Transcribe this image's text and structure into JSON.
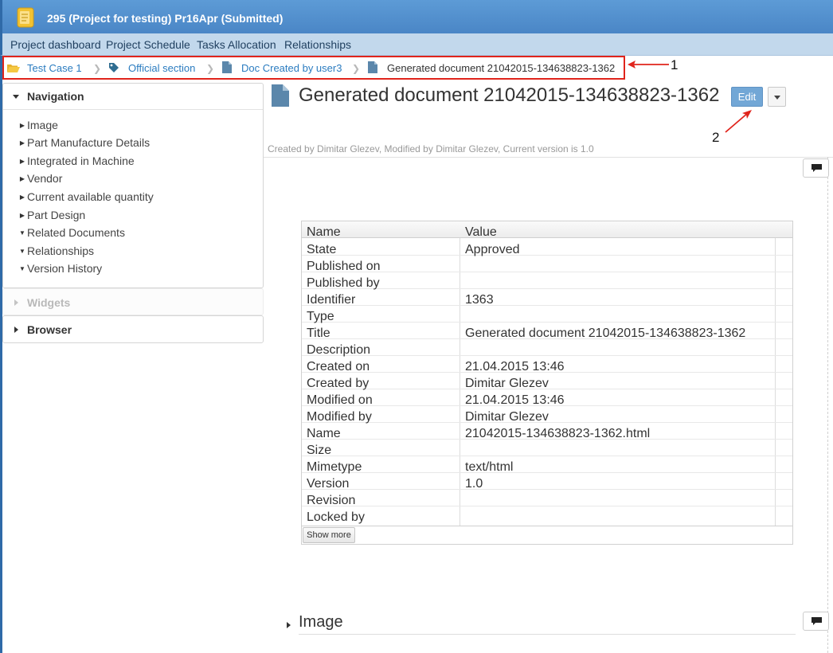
{
  "window": {
    "title": "295 (Project for testing) Pr16Apr (Submitted)"
  },
  "menu": {
    "items": [
      "Project dashboard",
      "Project Schedule",
      "Tasks Allocation",
      "Relationships"
    ]
  },
  "breadcrumb": {
    "items": [
      "Test Case 1",
      "Official section",
      "Doc Created by user3",
      "Generated document 21042015-134638823-1362"
    ]
  },
  "annotations": {
    "callout_1": "1",
    "callout_2": "2",
    "color": "#e0241c"
  },
  "navigation_panel": {
    "title": "Navigation",
    "items": [
      {
        "label": "Image",
        "expanded": false
      },
      {
        "label": "Part Manufacture Details",
        "expanded": false
      },
      {
        "label": "Integrated in Machine",
        "expanded": false
      },
      {
        "label": "Vendor",
        "expanded": false
      },
      {
        "label": "Current available quantity",
        "expanded": false
      },
      {
        "label": "Part Design",
        "expanded": false
      },
      {
        "label": "Related Documents",
        "expanded": true
      },
      {
        "label": "Relationships",
        "expanded": true
      },
      {
        "label": "Version History",
        "expanded": true
      }
    ]
  },
  "widgets_panel": {
    "title": "Widgets"
  },
  "browser_panel": {
    "title": "Browser"
  },
  "document": {
    "title": "Generated document 21042015-134638823-1362",
    "edit_label": "Edit",
    "meta": "Created by Dimitar Glezev, Modified by Dimitar Glezev, Current version is 1.0"
  },
  "properties": {
    "headers": [
      "Name",
      "Value"
    ],
    "rows": [
      [
        "State",
        "Approved"
      ],
      [
        "Published on",
        ""
      ],
      [
        "Published by",
        ""
      ],
      [
        "Identifier",
        "1363"
      ],
      [
        "Type",
        ""
      ],
      [
        "Title",
        "Generated document 21042015-134638823-1362"
      ],
      [
        "Description",
        ""
      ],
      [
        "Created on",
        "21.04.2015 13:46"
      ],
      [
        "Created by",
        "Dimitar Glezev"
      ],
      [
        "Modified on",
        "21.04.2015 13:46"
      ],
      [
        "Modified by",
        "Dimitar Glezev"
      ],
      [
        "Name",
        "21042015-134638823-1362.html"
      ],
      [
        "Size",
        ""
      ],
      [
        "Mimetype",
        "text/html"
      ],
      [
        "Version",
        "1.0"
      ],
      [
        "Revision",
        ""
      ],
      [
        "Locked by",
        ""
      ]
    ],
    "show_more_label": "Show more"
  },
  "image_section": {
    "title": "Image"
  },
  "colors": {
    "titlebar": "#4a86c6",
    "menubar": "#c2d8ec",
    "link": "#2b7cc0",
    "edit_button": "#72a7d6"
  }
}
